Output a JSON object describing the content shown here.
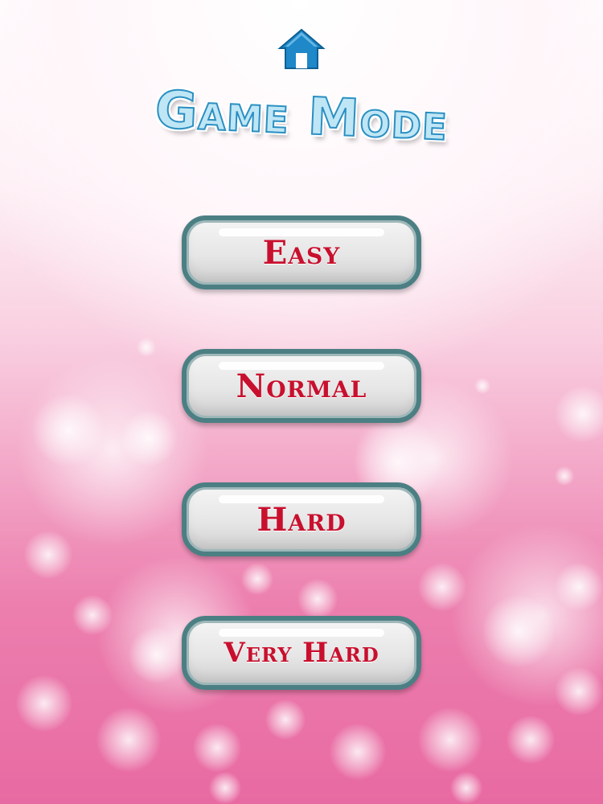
{
  "screen": {
    "title": "Game Mode",
    "home_icon": "home-icon"
  },
  "modes": [
    {
      "label": "Easy"
    },
    {
      "label": "Normal"
    },
    {
      "label": "Hard"
    },
    {
      "label": "Very Hard"
    }
  ],
  "colors": {
    "title_fill": "#bfe6f5",
    "title_outline": "#2b8fc2",
    "button_border": "#4b7f83",
    "button_label": "#c8102e",
    "home_icon": "#1e88c8"
  }
}
